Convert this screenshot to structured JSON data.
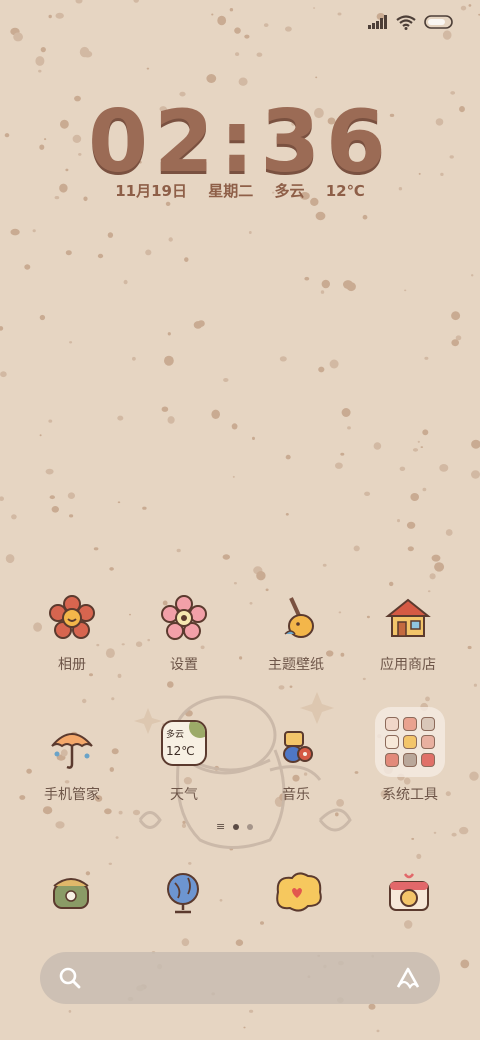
{
  "status_bar": {
    "icons": [
      "signal-icon",
      "wifi-icon",
      "battery-icon"
    ]
  },
  "clock": {
    "time": "02:36"
  },
  "date_line": {
    "date": "11月19日",
    "weekday": "星期二",
    "weather": "多云",
    "temperature": "12℃"
  },
  "apps_row1": [
    {
      "label": "相册",
      "icon": "flower-icon"
    },
    {
      "label": "设置",
      "icon": "pink-flower-gear-icon"
    },
    {
      "label": "主题壁纸",
      "icon": "paintbrush-bird-icon"
    },
    {
      "label": "应用商店",
      "icon": "house-icon"
    }
  ],
  "apps_row2": [
    {
      "label": "手机管家",
      "icon": "umbrella-icon"
    },
    {
      "label": "天气",
      "icon": "weather-icon",
      "widget_text": "多云",
      "widget_temp": "12℃"
    },
    {
      "label": "音乐",
      "icon": "music-bird-icon"
    },
    {
      "label": "系统工具",
      "icon": "folder-icon"
    }
  ],
  "pager": {
    "page_count": 2,
    "active_index": 0
  },
  "dock": [
    {
      "icon": "phone-icon"
    },
    {
      "icon": "globe-icon"
    },
    {
      "icon": "message-bubble-icon"
    },
    {
      "icon": "camera-icon"
    }
  ],
  "search_bar": {
    "icons": [
      "search-icon",
      "assistant-icon"
    ]
  },
  "colors": {
    "background": "#e6d5c2",
    "clock": "#9b6b55",
    "text": "#6e5649"
  }
}
